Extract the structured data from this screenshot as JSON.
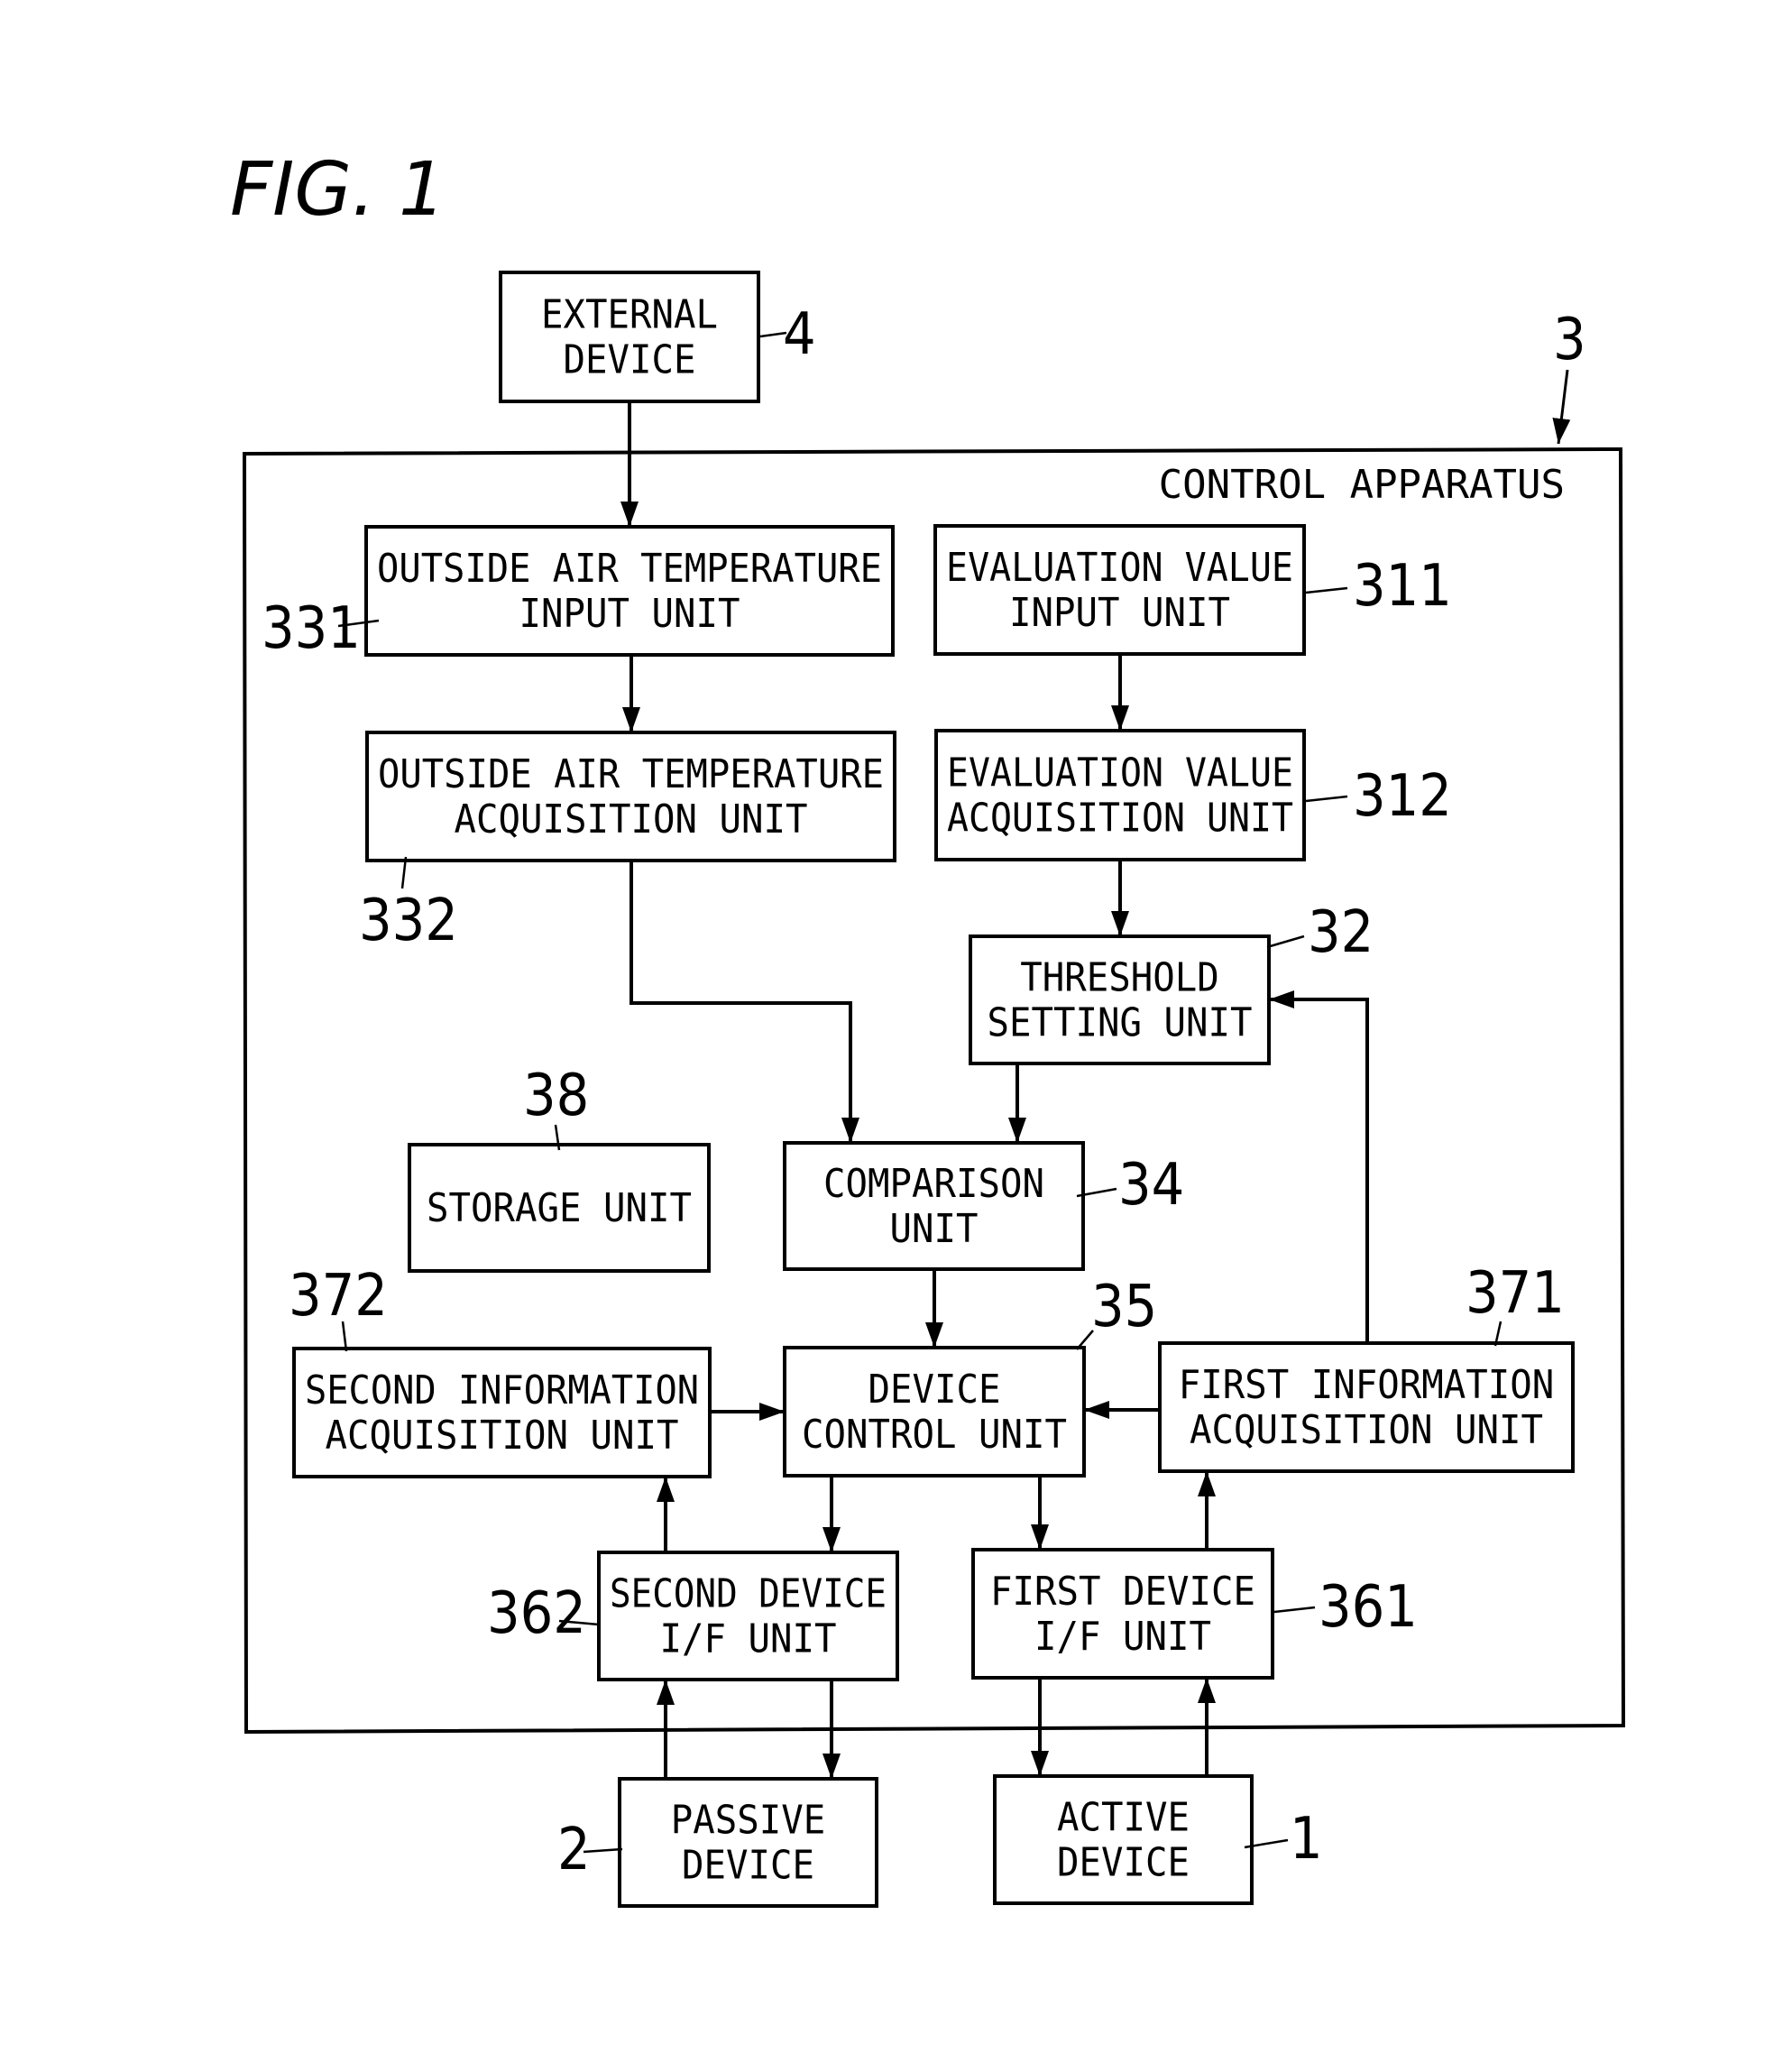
{
  "figure_label": "FIG. 1",
  "container": {
    "ref": "3",
    "label": "CONTROL APPARATUS"
  },
  "blocks": {
    "external_device": {
      "ref": "4",
      "lines": [
        "EXTERNAL",
        "DEVICE"
      ]
    },
    "oat_input": {
      "ref": "331",
      "lines": [
        "OUTSIDE AIR TEMPERATURE",
        "INPUT UNIT"
      ]
    },
    "eval_input": {
      "ref": "311",
      "lines": [
        "EVALUATION VALUE",
        "INPUT UNIT"
      ]
    },
    "oat_acq": {
      "ref": "332",
      "lines": [
        "OUTSIDE AIR TEMPERATURE",
        "ACQUISITION UNIT"
      ]
    },
    "eval_acq": {
      "ref": "312",
      "lines": [
        "EVALUATION VALUE",
        "ACQUISITION UNIT"
      ]
    },
    "threshold": {
      "ref": "32",
      "lines": [
        "THRESHOLD",
        "SETTING UNIT"
      ]
    },
    "storage": {
      "ref": "38",
      "lines": [
        "STORAGE UNIT"
      ]
    },
    "comparison": {
      "ref": "34",
      "lines": [
        "COMPARISON",
        "UNIT"
      ]
    },
    "second_info": {
      "ref": "372",
      "lines": [
        "SECOND INFORMATION",
        "ACQUISITION UNIT"
      ]
    },
    "device_control": {
      "ref": "35",
      "lines": [
        "DEVICE",
        "CONTROL UNIT"
      ]
    },
    "first_info": {
      "ref": "371",
      "lines": [
        "FIRST INFORMATION",
        "ACQUISITION UNIT"
      ]
    },
    "second_if": {
      "ref": "362",
      "lines": [
        "SECOND DEVICE",
        "I/F UNIT"
      ]
    },
    "first_if": {
      "ref": "361",
      "lines": [
        "FIRST DEVICE",
        "I/F UNIT"
      ]
    },
    "passive_device": {
      "ref": "2",
      "lines": [
        "PASSIVE",
        "DEVICE"
      ]
    },
    "active_device": {
      "ref": "1",
      "lines": [
        "ACTIVE",
        "DEVICE"
      ]
    }
  },
  "connections": [
    {
      "from": "external_device",
      "to": "oat_input"
    },
    {
      "from": "oat_input",
      "to": "oat_acq"
    },
    {
      "from": "eval_input",
      "to": "eval_acq"
    },
    {
      "from": "eval_acq",
      "to": "threshold"
    },
    {
      "from": "oat_acq",
      "to": "comparison"
    },
    {
      "from": "threshold",
      "to": "comparison"
    },
    {
      "from": "first_info",
      "to": "threshold"
    },
    {
      "from": "comparison",
      "to": "device_control"
    },
    {
      "from": "second_info",
      "to": "device_control"
    },
    {
      "from": "first_info",
      "to": "device_control"
    },
    {
      "from": "device_control",
      "to": "second_if"
    },
    {
      "from": "device_control",
      "to": "first_if"
    },
    {
      "from": "second_if",
      "to": "second_info"
    },
    {
      "from": "first_if",
      "to": "first_info"
    },
    {
      "from": "second_if",
      "to": "passive_device"
    },
    {
      "from": "passive_device",
      "to": "second_if"
    },
    {
      "from": "first_if",
      "to": "active_device"
    },
    {
      "from": "active_device",
      "to": "first_if"
    }
  ]
}
